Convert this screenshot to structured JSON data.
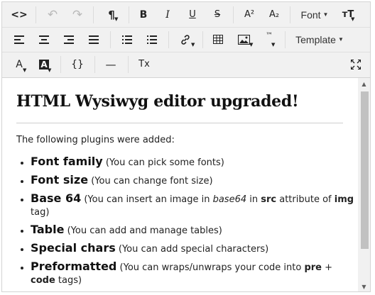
{
  "toolbar": {
    "row1": {
      "source": "<>",
      "undo": "↶",
      "redo": "↷",
      "paragraph": "¶",
      "bold": "B",
      "italic": "I",
      "underline": "U",
      "strike": "S",
      "superscript": "A²",
      "subscript": "A₂",
      "font_label": "Font",
      "font_size": "тT"
    },
    "row2": {
      "template_label": "Template",
      "special_char": "™"
    },
    "row3": {
      "text_color": "A",
      "bg_color": "A",
      "code": "{}",
      "hr": "—",
      "clear_format": "Tx"
    }
  },
  "content": {
    "title": "HTML Wysiwyg editor upgraded!",
    "intro": "The following plugins were added:",
    "items": [
      {
        "name": "Font family",
        "desc": "(You can pick some fonts)"
      },
      {
        "name": "Font size",
        "desc": "(You can change font size)"
      },
      {
        "name": "Base 64",
        "desc_pre": "(You can insert an image in ",
        "desc_em": "base64",
        "desc_mid": " in ",
        "desc_b1": "src",
        "desc_mid2": " attribute of ",
        "desc_b2": "img",
        "desc_post": " tag)"
      },
      {
        "name": "Table",
        "desc": "(You can add and manage tables)"
      },
      {
        "name": "Special chars",
        "desc": "(You can add special characters)"
      },
      {
        "name": "Preformatted",
        "desc_pre": "(You can wraps/unwraps your code into ",
        "desc_b1": "pre",
        "desc_mid": " + ",
        "desc_b2": "code",
        "desc_post": " tags)"
      }
    ]
  },
  "colors": {
    "toolbar_bg": "#f1f1f1",
    "border": "#d4d4d4",
    "scroll_thumb": "#c1c1c1"
  }
}
